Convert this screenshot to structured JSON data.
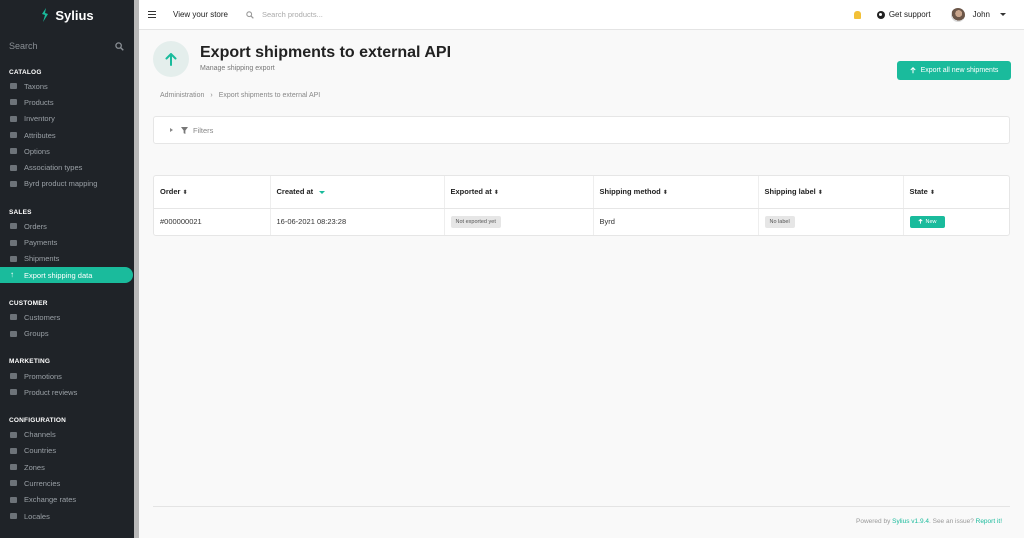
{
  "brand": {
    "name": "Sylius",
    "accent": "#1abb9c"
  },
  "sidebar": {
    "search_label": "Search",
    "sections": [
      {
        "title": "CATALOG",
        "items": [
          "Taxons",
          "Products",
          "Inventory",
          "Attributes",
          "Options",
          "Association types",
          "Byrd product mapping"
        ]
      },
      {
        "title": "SALES",
        "items": [
          "Orders",
          "Payments",
          "Shipments",
          "Export shipping data"
        ]
      },
      {
        "title": "CUSTOMER",
        "items": [
          "Customers",
          "Groups"
        ]
      },
      {
        "title": "MARKETING",
        "items": [
          "Promotions",
          "Product reviews"
        ]
      },
      {
        "title": "CONFIGURATION",
        "items": [
          "Channels",
          "Countries",
          "Zones",
          "Currencies",
          "Exchange rates",
          "Locales"
        ]
      }
    ],
    "active_item": "Export shipping data"
  },
  "topbar": {
    "view_store": "View your store",
    "search_placeholder": "Search products...",
    "support": "Get support",
    "user": "John"
  },
  "header": {
    "title": "Export shipments to external API",
    "subtitle": "Manage shipping export",
    "export_button": "Export all new shipments"
  },
  "breadcrumb": [
    "Administration",
    "Export shipments to external API"
  ],
  "filters": {
    "label": "Filters"
  },
  "table": {
    "columns": [
      "Order",
      "Created at",
      "Exported at",
      "Shipping method",
      "Shipping label",
      "State"
    ],
    "rows": [
      {
        "order": "#000000021",
        "created_at": "16-06-2021 08:23:28",
        "exported_at": "Not exported yet",
        "shipping_method": "Byrd",
        "shipping_label": "No label",
        "state": "New"
      }
    ]
  },
  "footer": {
    "powered": "Powered by",
    "version": "Sylius v1.9.4",
    "issue": ". See an issue?",
    "report": "Report it!"
  }
}
